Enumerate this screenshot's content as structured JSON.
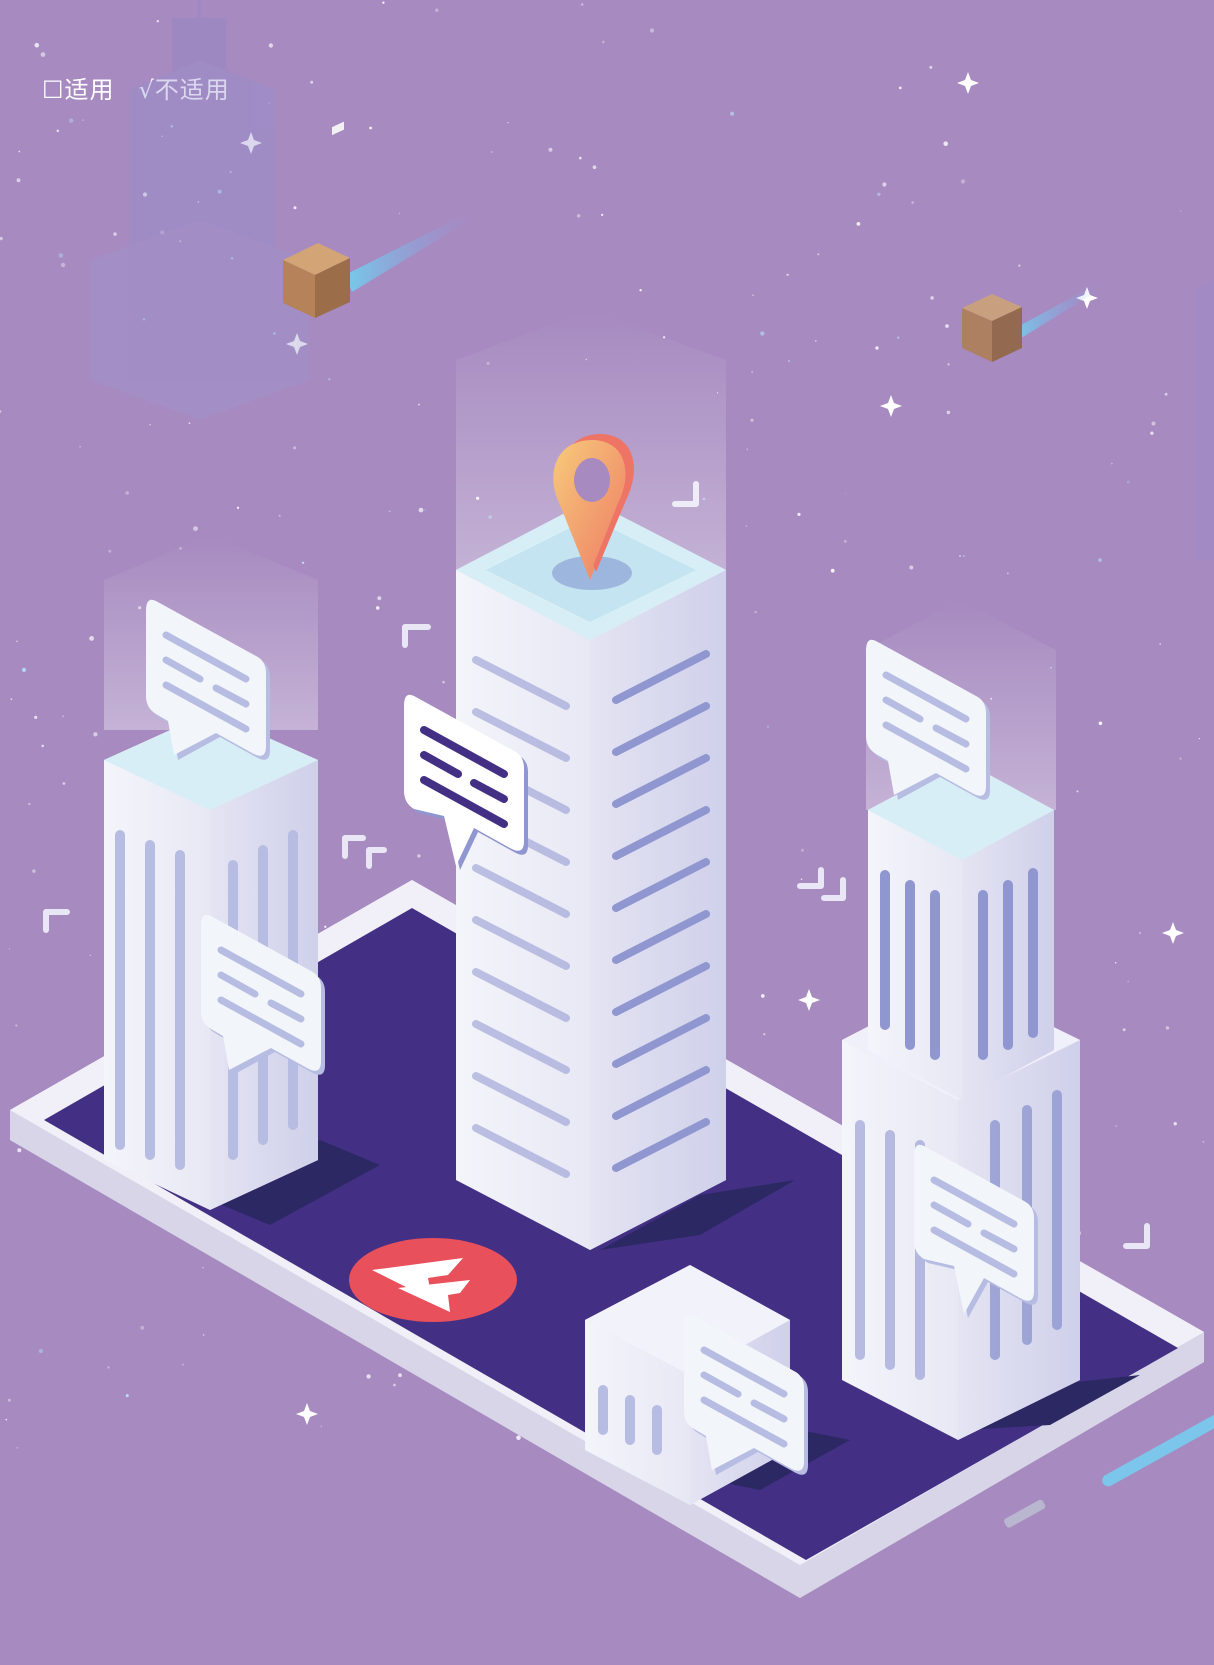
{
  "header": {
    "applicable_option": "☐适用",
    "not_applicable_option": "√不适用"
  },
  "colors": {
    "background": "#a68ac0",
    "phone_screen": "#433084",
    "building_white": "#eeeef8",
    "building_stripe": "#8f96d0",
    "location_pin": "#f2a65a",
    "logo_red": "#e8505b"
  },
  "icons": {
    "location_pin": "location-pin-icon",
    "chat_bubble": "chat-bubble-icon",
    "delivery_box": "package-box-icon",
    "app_logo": "app-logo-icon"
  }
}
